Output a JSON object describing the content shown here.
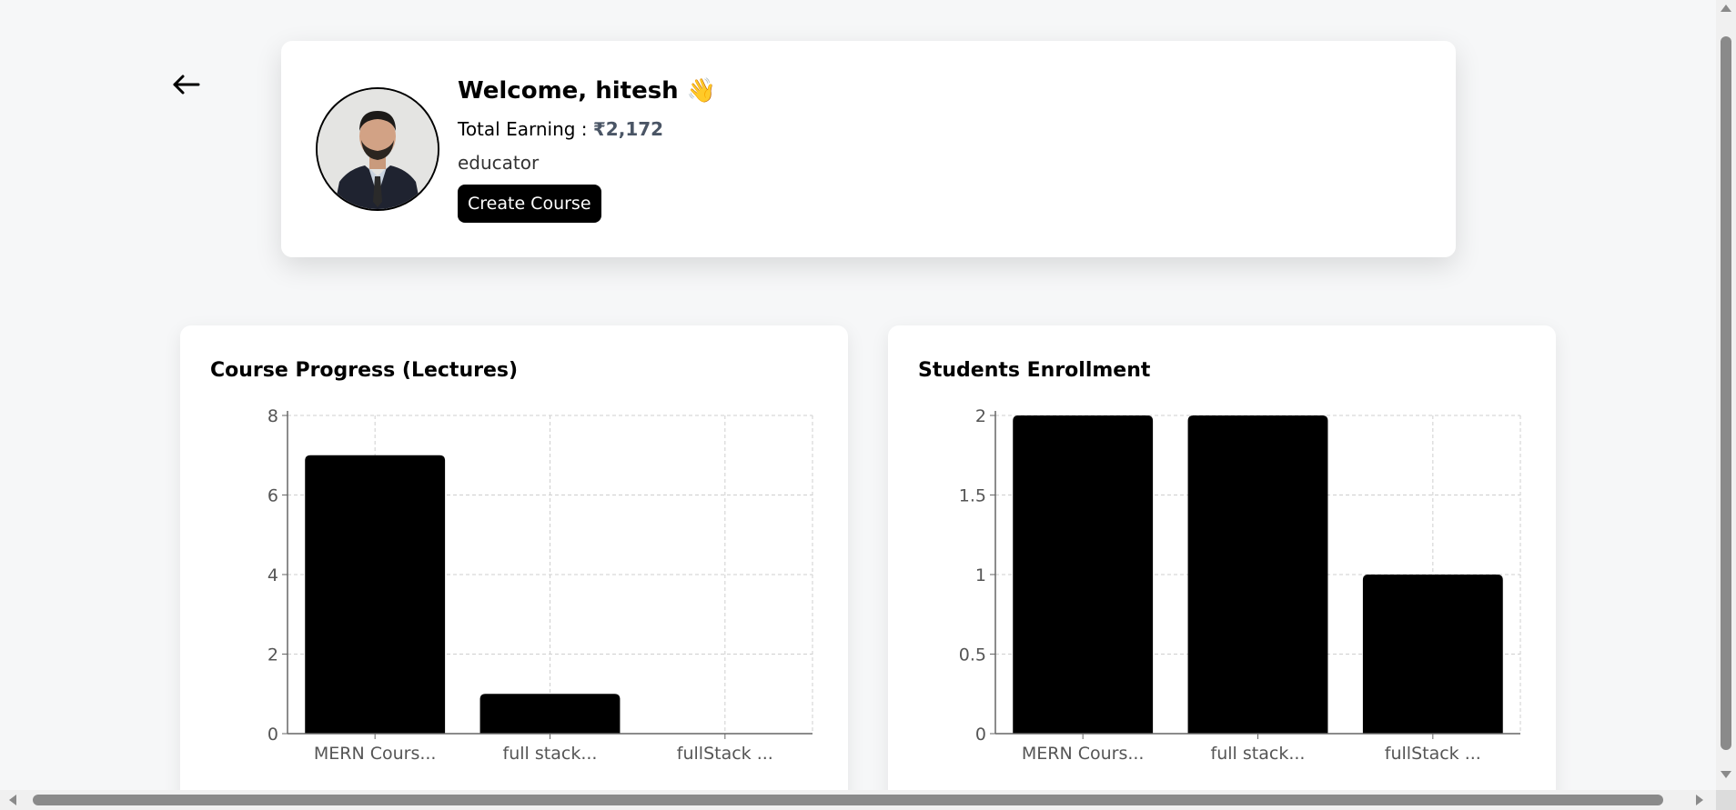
{
  "profile": {
    "welcome_text": "Welcome, hitesh 👋",
    "earning_label": "Total Earning : ",
    "earning_value": "₹2,172",
    "role": "educator",
    "create_button_label": "Create Course"
  },
  "icons": {
    "back": "arrow-left-icon",
    "avatar": "user-photo"
  },
  "colors": {
    "bar_fill": "#000000",
    "earning_value": "#4a5565",
    "page_background": "#f6f7f8"
  },
  "charts": {
    "progress_title": "Course Progress (Lectures)",
    "enrollment_title": "Students Enrollment"
  },
  "chart_data": [
    {
      "type": "bar",
      "title": "Course Progress (Lectures)",
      "categories": [
        "MERN Cours...",
        "full stack...",
        "fullStack ..."
      ],
      "values": [
        7,
        1,
        0
      ],
      "yticks": [
        "0",
        "2",
        "4",
        "6",
        "8"
      ],
      "ylim": [
        0,
        8
      ],
      "grid": true,
      "xlabel": "",
      "ylabel": ""
    },
    {
      "type": "bar",
      "title": "Students Enrollment",
      "categories": [
        "MERN Cours...",
        "full stack...",
        "fullStack ..."
      ],
      "values": [
        2,
        2,
        1
      ],
      "yticks": [
        "0",
        "0.5",
        "1",
        "1.5",
        "2"
      ],
      "ylim": [
        0,
        2
      ],
      "grid": true,
      "xlabel": "",
      "ylabel": ""
    }
  ]
}
